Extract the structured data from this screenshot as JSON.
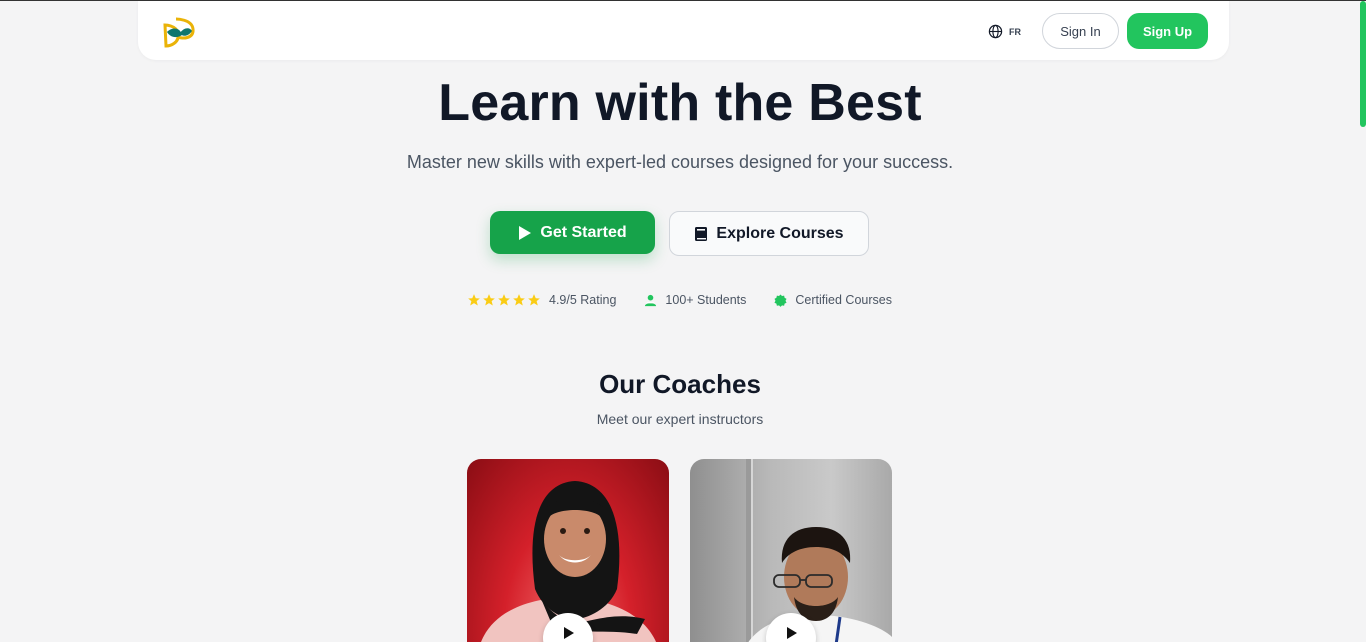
{
  "header": {
    "language": "FR",
    "sign_in": "Sign In",
    "sign_up": "Sign Up"
  },
  "hero": {
    "title": "Learn with the Best",
    "subtitle": "Master new skills with expert-led courses designed for your success.",
    "primary_button": "Get Started",
    "secondary_button": "Explore Courses"
  },
  "stats": [
    {
      "label": "4.9/5 Rating",
      "icon": "star-icon",
      "rating": 4.9,
      "max": 5
    },
    {
      "label": "100+ Students",
      "icon": "student-icon"
    },
    {
      "label": "Certified Courses",
      "icon": "certificate-icon"
    }
  ],
  "coaches": {
    "title": "Our Coaches",
    "subtitle": "Meet our expert instructors",
    "cards": [
      {
        "name": "coach-card-1",
        "icon": "play-icon"
      },
      {
        "name": "coach-card-2",
        "icon": "play-icon"
      }
    ]
  },
  "colors": {
    "brand_green": "#16a34a",
    "signup_green": "#22c55e",
    "star_yellow": "#facc15",
    "text_dark": "#111827"
  }
}
